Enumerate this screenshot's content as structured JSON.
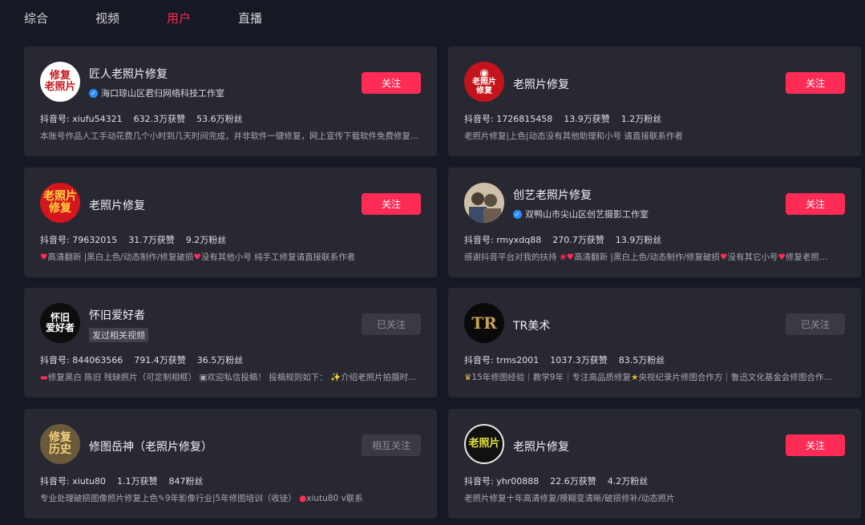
{
  "tabs": [
    {
      "label": "综合"
    },
    {
      "label": "视频"
    },
    {
      "label": "用户"
    },
    {
      "label": "直播"
    }
  ],
  "colors": {
    "accent": "#fe2c55",
    "background": "#161823",
    "card": "#272832"
  },
  "cards": [
    {
      "avatar_text": [
        "修复",
        "老照片"
      ],
      "name": "匠人老照片修复",
      "sub": "海口琼山区君归网络科技工作室",
      "button": "关注",
      "douyin_id": "抖音号: xiufu54321",
      "likes": "632.3万获赞",
      "fans": "53.6万粉丝",
      "desc": "本账号作品人工手动花费几个小时到几天时间完成，并非软件一键修复，网上宣传下载软件免费修复…"
    },
    {
      "avatar_text": [
        "老照片",
        "修复"
      ],
      "name": "老照片修复",
      "button": "关注",
      "douyin_id": "抖音号: 1726815458",
      "likes": "13.9万获赞",
      "fans": "1.2万粉丝",
      "desc": "老照片修复|上色|动态没有其他助理和小号 请直接联系作者"
    },
    {
      "avatar_text": [
        "老照片",
        "修复"
      ],
      "name": "老照片修复",
      "button": "关注",
      "douyin_id": "抖音号: 79632015",
      "likes": "31.7万获赞",
      "fans": "9.2万粉丝",
      "desc": "高清翻新 |黑白上色/动态制作/修复破损",
      "desc2": "没有其他小号 纯手工修复请直接联系作者"
    },
    {
      "avatar_text": [],
      "name": "创艺老照片修复",
      "sub": "双鸭山市尖山区创艺摄影工作室",
      "button": "关注",
      "douyin_id": "抖音号: rmyxdq88",
      "likes": "270.7万获赞",
      "fans": "13.9万粉丝",
      "desc": "感谢抖音平台对我的扶持",
      "desc2": "高清翻新 |黑白上色/动态制作/修复破损",
      "desc3": "没有其它小号",
      "desc4": "修复老照…"
    },
    {
      "avatar_text": [
        "怀旧",
        "爱好者"
      ],
      "name": "怀旧爱好者",
      "sub": "发过相关视频",
      "button": "已关注",
      "douyin_id": "抖音号: 844063566",
      "likes": "791.4万获赞",
      "fans": "36.5万粉丝",
      "desc": "修复黑白 陈旧 残缺照片（可定制相框）",
      "desc2": "欢迎私信投稿！ 投稿规则如下：",
      "desc3": "介绍老照片拍摄时…"
    },
    {
      "avatar_text": [
        "TR"
      ],
      "name": "TR美术",
      "button": "已关注",
      "douyin_id": "抖音号: trms2001",
      "likes": "1037.3万获赞",
      "fans": "83.5万粉丝",
      "desc": "15年修图经验｜教学9年｜专注高品质修复",
      "desc2": "央视纪录片修图合作方｜鲁迅文化基金会修图合作…"
    },
    {
      "avatar_text": [
        "修复",
        "历史"
      ],
      "name": "修图岳神（老照片修复）",
      "button": "相互关注",
      "douyin_id": "抖音号: xiutu80",
      "likes": "1.1万获赞",
      "fans": "847粉丝",
      "desc": "专业处理破损图像照片修复上色",
      "desc2": "9年影像行业|5年修图培训（收徒）",
      "desc3": "xiutu80 v联系"
    },
    {
      "avatar_text": [
        "老照片"
      ],
      "name": "老照片修复",
      "button": "关注",
      "douyin_id": "抖音号: yhr00888",
      "likes": "22.6万获赞",
      "fans": "4.2万粉丝",
      "desc": "老照片修复十年高清修复/模糊变清晰/破损修补/动态照片"
    }
  ]
}
